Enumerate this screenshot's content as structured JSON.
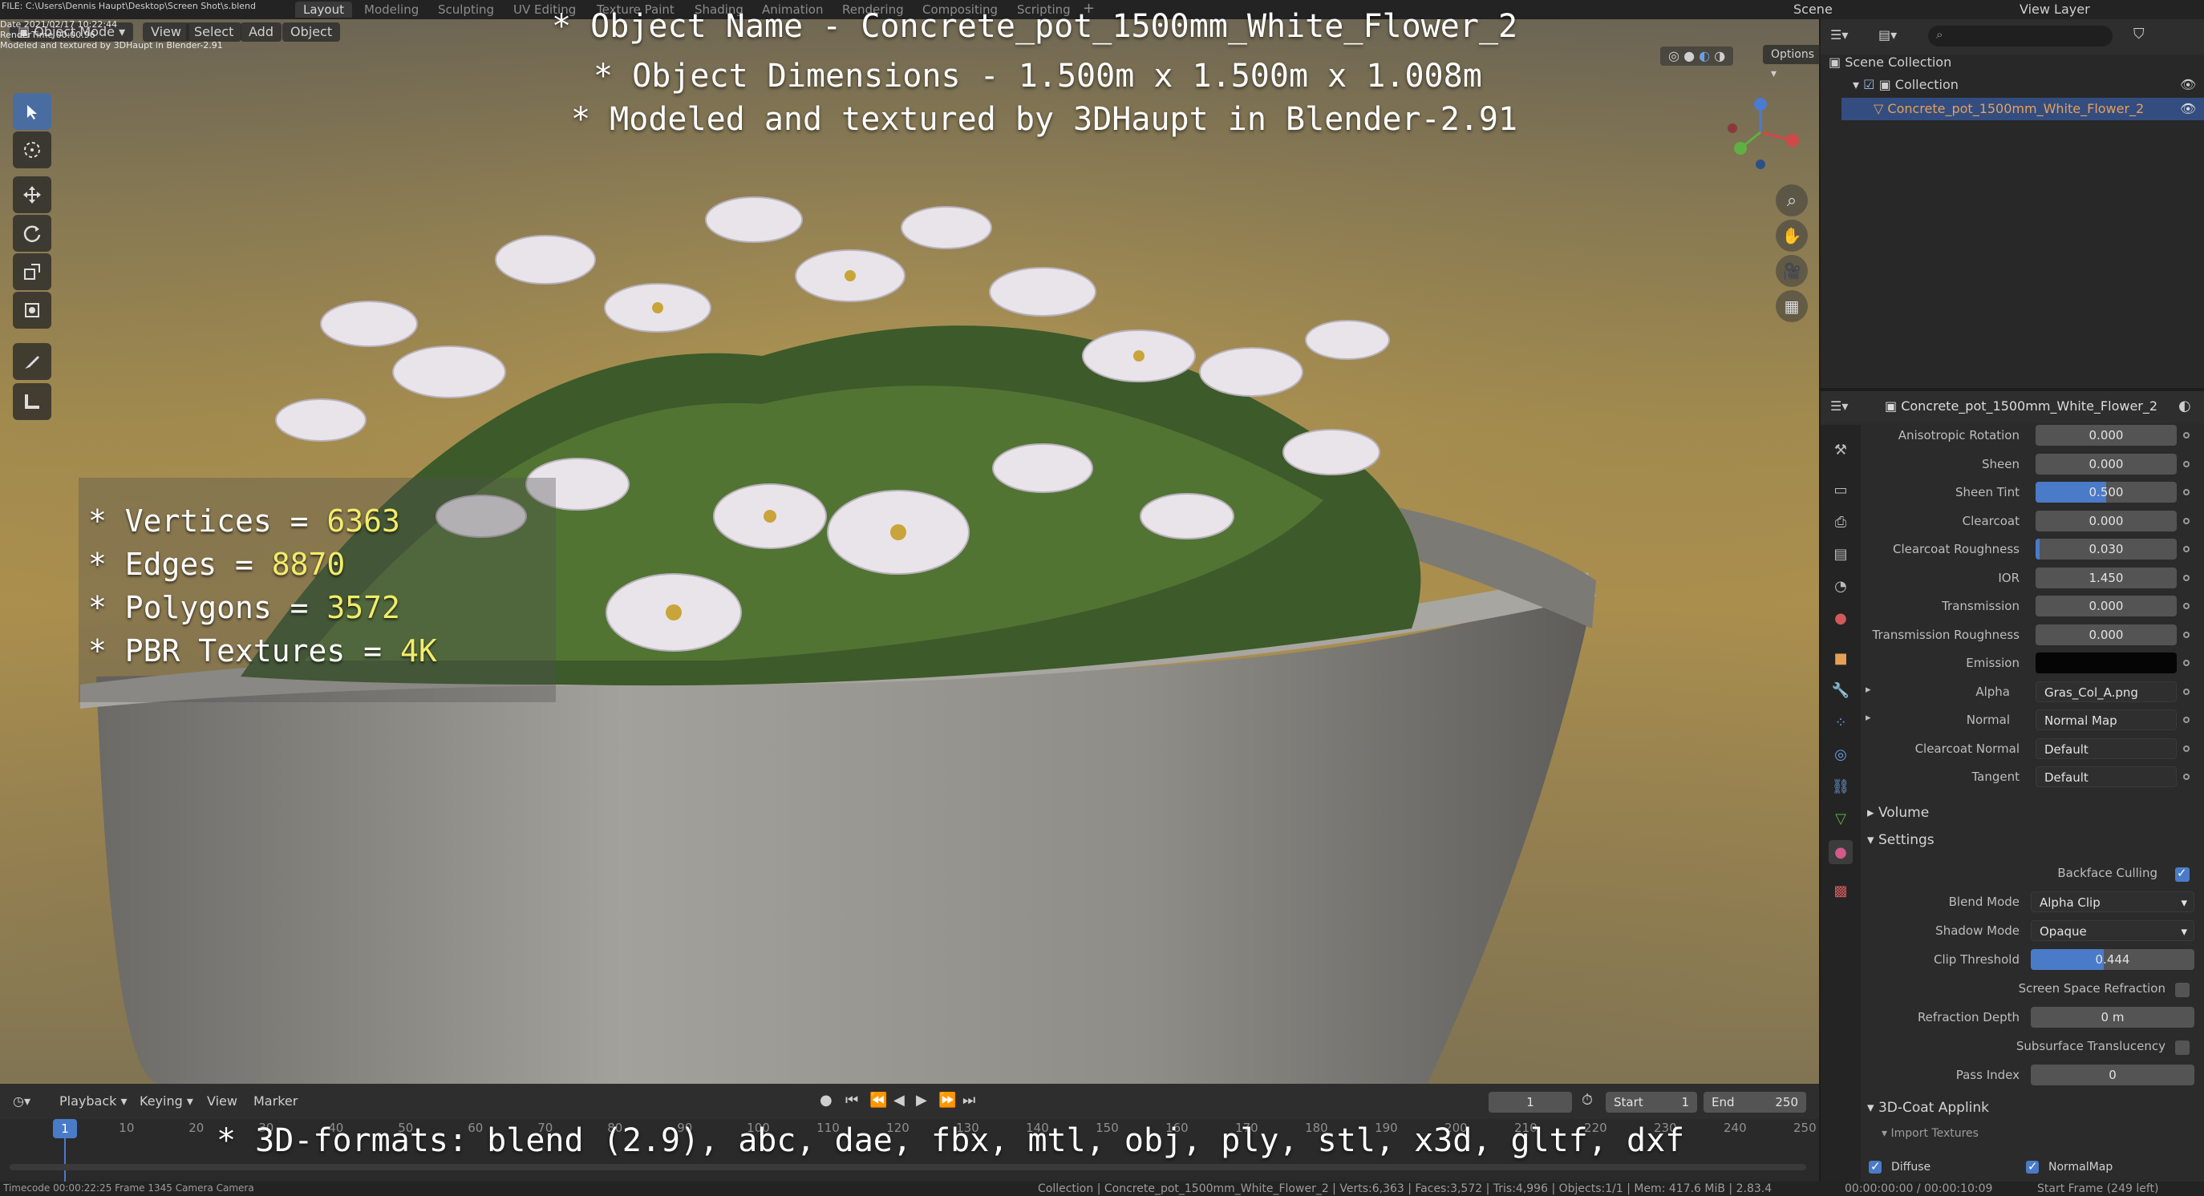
{
  "topbar": {
    "file_path": "FILE: C:\\Users\\Dennis Haupt\\Desktop\\Screen Shot\\s.blend",
    "date": "Date 2021/02/17 10:22:44",
    "render_time": "RenderTime 00:00.96",
    "note": "Modeled and textured by 3DHaupt in Blender-2.91",
    "workspaces": [
      "Layout",
      "Modeling",
      "Sculpting",
      "UV Editing",
      "Texture Paint",
      "Shading",
      "Animation",
      "Rendering",
      "Compositing",
      "Scripting"
    ],
    "active_workspace": "Layout",
    "scene_label": "Scene",
    "view_layer_label": "View Layer"
  },
  "viewport": {
    "mode": "Object Mode",
    "menu": [
      "View",
      "Select",
      "Add",
      "Object"
    ],
    "options_label": "Options",
    "overlay": {
      "title": "* Object Name - Concrete_pot_1500mm_White_Flower_2",
      "dimensions": "* Object Dimensions -  1.500m x 1.500m x 1.008m",
      "credit": "* Modeled and textured by 3DHaupt in Blender-2.91",
      "formats": "* 3D-formats: blend (2.9), abc, dae, fbx, mtl, obj, ply, stl, x3d, gltf, dxf"
    },
    "stats": [
      {
        "key": "* Vertices = ",
        "value": "6363"
      },
      {
        "key": "* Edges = ",
        "value": "8870"
      },
      {
        "key": "* Polygons = ",
        "value": "3572"
      },
      {
        "key": "* PBR Textures = ",
        "value": "4K"
      }
    ],
    "tools": [
      "select-box-icon",
      "cursor-icon",
      "move-icon",
      "rotate-icon",
      "scale-icon",
      "transform-icon",
      "annotate-icon",
      "measure-icon"
    ]
  },
  "outliner": {
    "search_placeholder": "",
    "root": "Scene Collection",
    "collection": "Collection",
    "object": "Concrete_pot_1500mm_White_Flower_2"
  },
  "properties": {
    "object_name": "Concrete_pot_1500mm_White_Flower_2",
    "rows": [
      {
        "label": "Anisotropic Rotation",
        "value": "0.000",
        "kind": "num"
      },
      {
        "label": "Sheen",
        "value": "0.000",
        "kind": "num"
      },
      {
        "label": "Sheen Tint",
        "value": "0.500",
        "kind": "num",
        "fill": 0.5
      },
      {
        "label": "Clearcoat",
        "value": "0.000",
        "kind": "num"
      },
      {
        "label": "Clearcoat Roughness",
        "value": "0.030",
        "kind": "num",
        "fill": 0.03
      },
      {
        "label": "IOR",
        "value": "1.450",
        "kind": "num"
      },
      {
        "label": "Transmission",
        "value": "0.000",
        "kind": "num"
      },
      {
        "label": "Transmission Roughness",
        "value": "0.000",
        "kind": "num"
      },
      {
        "label": "Emission",
        "value": "",
        "kind": "black"
      },
      {
        "label": "Alpha",
        "value": "Gras_Col_A.png",
        "kind": "txt"
      },
      {
        "label": "Normal",
        "value": "Normal Map",
        "kind": "txt"
      },
      {
        "label": "Clearcoat Normal",
        "value": "Default",
        "kind": "txt"
      },
      {
        "label": "Tangent",
        "value": "Default",
        "kind": "txt"
      }
    ],
    "volume_label": "Volume",
    "settings_label": "Settings",
    "backface_culling": "Backface Culling",
    "blend_mode_label": "Blend Mode",
    "blend_mode_value": "Alpha Clip",
    "shadow_mode_label": "Shadow Mode",
    "shadow_mode_value": "Opaque",
    "clip_threshold_label": "Clip Threshold",
    "clip_threshold_value": "0.444",
    "clip_threshold_fill": 0.444,
    "ssr_label": "Screen Space Refraction",
    "refraction_depth_label": "Refraction Depth",
    "refraction_depth_value": "0 m",
    "subsurface_label": "Subsurface Translucency",
    "pass_index_label": "Pass Index",
    "pass_index_value": "0",
    "coat_label": "3D-Coat Applink",
    "import_textures_label": "Import Textures",
    "diffuse_label": "Diffuse",
    "normalmap_label": "NormalMap"
  },
  "timeline": {
    "menu": [
      "Playback",
      "Keying",
      "View",
      "Marker"
    ],
    "current_frame": "1",
    "start_label": "Start",
    "start_value": "1",
    "end_label": "End",
    "end_value": "250",
    "frames": [
      "1",
      "10",
      "20",
      "30",
      "40",
      "50",
      "60",
      "70",
      "80",
      "90",
      "100",
      "110",
      "120",
      "130",
      "140",
      "150",
      "160",
      "170",
      "180",
      "190",
      "200",
      "210",
      "220",
      "230",
      "240",
      "250"
    ],
    "cursor_frame": "1"
  },
  "statusbar": {
    "left": "Timecode 00:00:22:25   Frame 1345   Camera Camera",
    "center": "Collection | Concrete_pot_1500mm_White_Flower_2 | Verts:6,363 | Faces:3,572 | Tris:4,996 | Objects:1/1 | Mem: 417.6 MiB | 2.83.4",
    "time": "00:00:00:00 / 00:00:10:09",
    "right": "Start Frame (249 left)"
  },
  "colors": {
    "accent": "#4a7bc8",
    "stat_value": "#f3ec6a",
    "overlay_text": "#ffffff"
  }
}
